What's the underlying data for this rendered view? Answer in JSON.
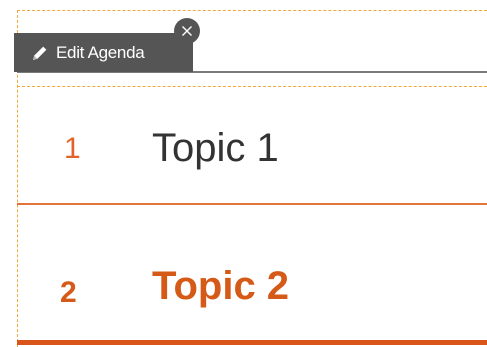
{
  "toolbar": {
    "edit_agenda_label": "Edit Agenda",
    "edit_icon": "pencil-icon",
    "close_icon": "close-icon"
  },
  "agenda": {
    "items": [
      {
        "number": "1",
        "title": "Topic 1",
        "active": false
      },
      {
        "number": "2",
        "title": "Topic 2",
        "active": true
      }
    ]
  },
  "colors": {
    "accent": "#d65a17",
    "chip_background": "#555555",
    "selection_outline": "#f0a93a",
    "text_default": "#333333"
  }
}
